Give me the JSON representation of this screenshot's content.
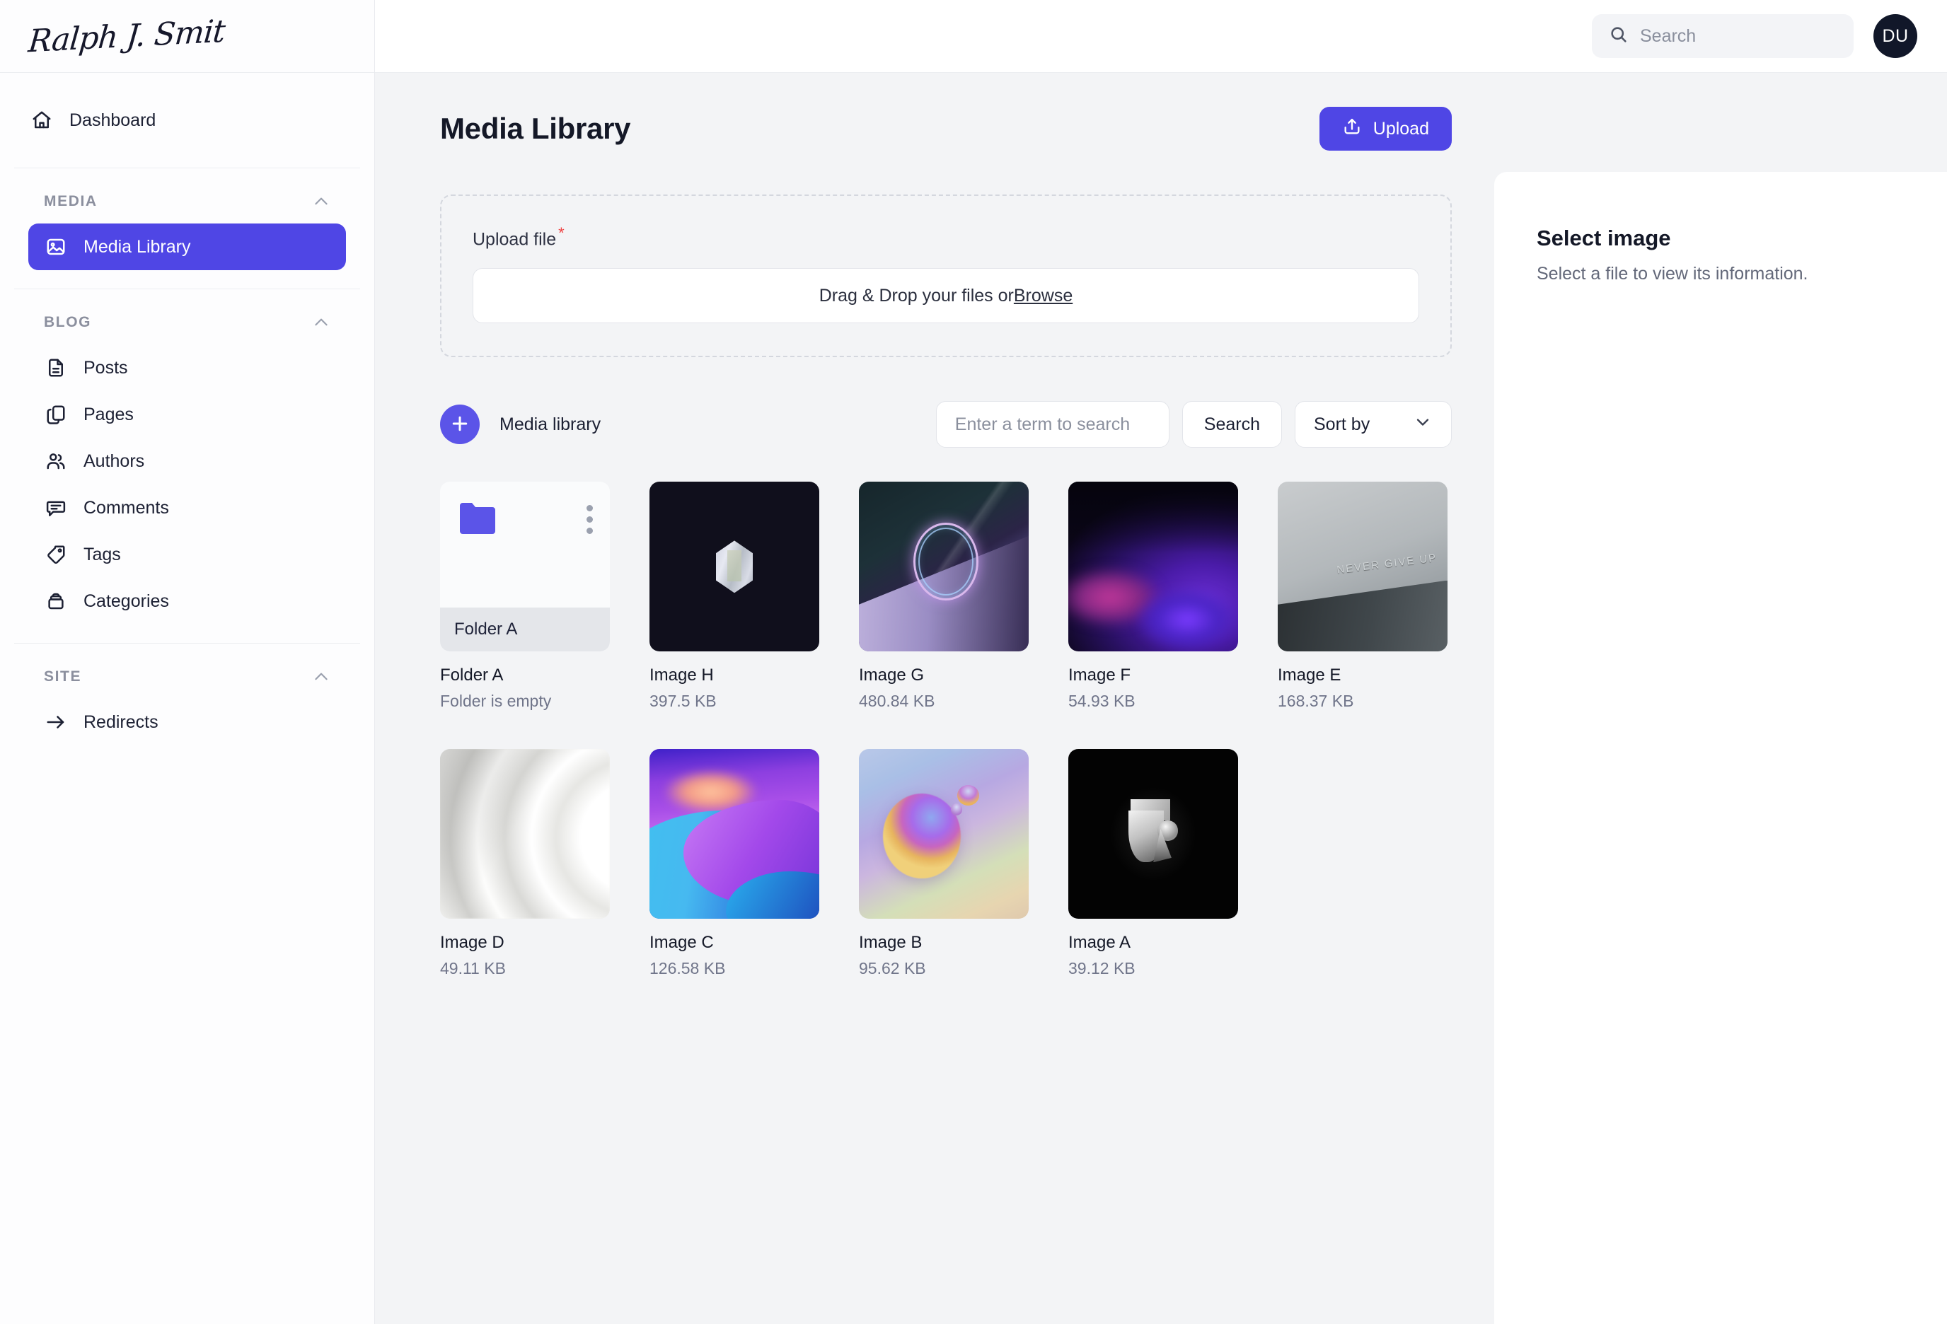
{
  "brand": {
    "logo_text": "Ralph J. Smit"
  },
  "topbar": {
    "search_placeholder": "Search",
    "search_value": "",
    "avatar_initials": "DU"
  },
  "sidebar": {
    "top_items": [
      {
        "label": "Dashboard",
        "icon": "home-icon"
      }
    ],
    "sections": [
      {
        "key": "media",
        "title": "MEDIA",
        "items": [
          {
            "label": "Media Library",
            "icon": "image-icon",
            "active": true
          }
        ]
      },
      {
        "key": "blog",
        "title": "BLOG",
        "items": [
          {
            "label": "Posts",
            "icon": "document-icon",
            "active": false
          },
          {
            "label": "Pages",
            "icon": "copy-icon",
            "active": false
          },
          {
            "label": "Authors",
            "icon": "users-icon",
            "active": false
          },
          {
            "label": "Comments",
            "icon": "comment-icon",
            "active": false
          },
          {
            "label": "Tags",
            "icon": "tag-icon",
            "active": false
          },
          {
            "label": "Categories",
            "icon": "archive-icon",
            "active": false
          }
        ]
      },
      {
        "key": "site",
        "title": "SITE",
        "items": [
          {
            "label": "Redirects",
            "icon": "arrow-right-icon",
            "active": false
          }
        ]
      }
    ]
  },
  "page": {
    "title": "Media Library",
    "upload_button": "Upload"
  },
  "upload": {
    "field_label": "Upload file",
    "required_mark": "*",
    "dropzone_text": "Drag & Drop your files or ",
    "dropzone_link": "Browse"
  },
  "toolbar": {
    "breadcrumb_label": "Media library",
    "add_label": "+",
    "search_placeholder": "Enter a term to search",
    "search_value": "",
    "search_button": "Search",
    "sort_label": "Sort by"
  },
  "grid": {
    "items": [
      {
        "kind": "folder",
        "name": "Folder A",
        "caption": "Folder A",
        "meta": "Folder is empty",
        "thumb": "folder"
      },
      {
        "kind": "image",
        "name": "Image H",
        "meta": "397.5 KB",
        "thumb": "crystal-dark"
      },
      {
        "kind": "image",
        "name": "Image G",
        "meta": "480.84 KB",
        "thumb": "ring-teal"
      },
      {
        "kind": "image",
        "name": "Image F",
        "meta": "54.93 KB",
        "thumb": "purple-wave"
      },
      {
        "kind": "image",
        "name": "Image E",
        "meta": "168.37 KB",
        "thumb": "never-give-up"
      },
      {
        "kind": "image",
        "name": "Image D",
        "meta": "49.11 KB",
        "thumb": "white-swirl"
      },
      {
        "kind": "image",
        "name": "Image C",
        "meta": "126.58 KB",
        "thumb": "violet-blue-wave"
      },
      {
        "kind": "image",
        "name": "Image B",
        "meta": "95.62 KB",
        "thumb": "pastel-bubble"
      },
      {
        "kind": "image",
        "name": "Image A",
        "meta": "39.12 KB",
        "thumb": "black-shape"
      }
    ]
  },
  "info_panel": {
    "title": "Select image",
    "subtitle": "Select a file to view its information."
  },
  "colors": {
    "accent": "#4f46e5",
    "accent_soft": "#5b54e8",
    "canvas": "#f3f4f6",
    "sidebar": "#fdfdfe",
    "text": "#141827",
    "muted": "#70758a",
    "required": "#ef4444",
    "avatar_bg": "#111729"
  }
}
